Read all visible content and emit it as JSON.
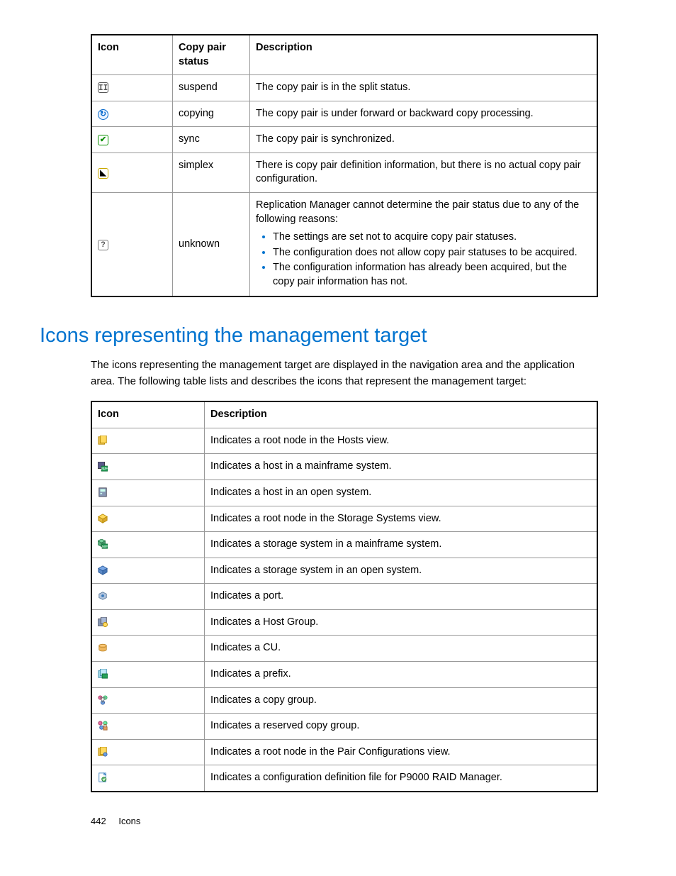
{
  "table1": {
    "headers": [
      "Icon",
      "Copy pair status",
      "Description"
    ],
    "rows": [
      {
        "icon": "suspend-icon",
        "status": "suspend",
        "desc": "The copy pair is in the split status."
      },
      {
        "icon": "copying-icon",
        "status": "copying",
        "desc": "The copy pair is under forward or backward copy processing."
      },
      {
        "icon": "sync-icon",
        "status": "sync",
        "desc": "The copy pair is synchronized."
      },
      {
        "icon": "simplex-icon",
        "status": "simplex",
        "desc": "There is copy pair definition information, but there is no actual copy pair configuration."
      },
      {
        "icon": "unknown-icon",
        "status": "unknown",
        "desc_intro": "Replication Manager cannot determine the pair status due to any of the following reasons:",
        "bullets": [
          "The settings are set not to acquire copy pair statuses.",
          "The configuration does not allow copy pair statuses to be acquired.",
          "The configuration information has already been acquired, but the copy pair information has not."
        ]
      }
    ]
  },
  "section_title": "Icons representing the management target",
  "intro_text": "The icons representing the management target are displayed in the navigation area and the application area. The following table lists and describes the icons that represent the management target:",
  "table2": {
    "headers": [
      "Icon",
      "Description"
    ],
    "rows": [
      {
        "icon": "hosts-root-icon",
        "desc": "Indicates a root node in the Hosts view."
      },
      {
        "icon": "host-mainframe-icon",
        "desc": "Indicates a host in a mainframe system."
      },
      {
        "icon": "host-open-icon",
        "desc": "Indicates a host in an open system."
      },
      {
        "icon": "storage-root-icon",
        "desc": "Indicates a root node in the Storage Systems view."
      },
      {
        "icon": "storage-mainframe-icon",
        "desc": "Indicates a storage system in a mainframe system."
      },
      {
        "icon": "storage-open-icon",
        "desc": "Indicates a storage system in an open system."
      },
      {
        "icon": "port-icon",
        "desc": "Indicates a port."
      },
      {
        "icon": "host-group-icon",
        "desc": "Indicates a Host Group."
      },
      {
        "icon": "cu-icon",
        "desc": "Indicates a CU."
      },
      {
        "icon": "prefix-icon",
        "desc": "Indicates a prefix."
      },
      {
        "icon": "copy-group-icon",
        "desc": "Indicates a copy group."
      },
      {
        "icon": "reserved-copy-group-icon",
        "desc": "Indicates a reserved copy group."
      },
      {
        "icon": "pair-config-root-icon",
        "desc": "Indicates a root node in the Pair Configurations view."
      },
      {
        "icon": "config-def-file-icon",
        "desc": "Indicates a configuration definition file for P9000 RAID Manager."
      }
    ]
  },
  "footer": {
    "page_number": "442",
    "section_label": "Icons"
  }
}
